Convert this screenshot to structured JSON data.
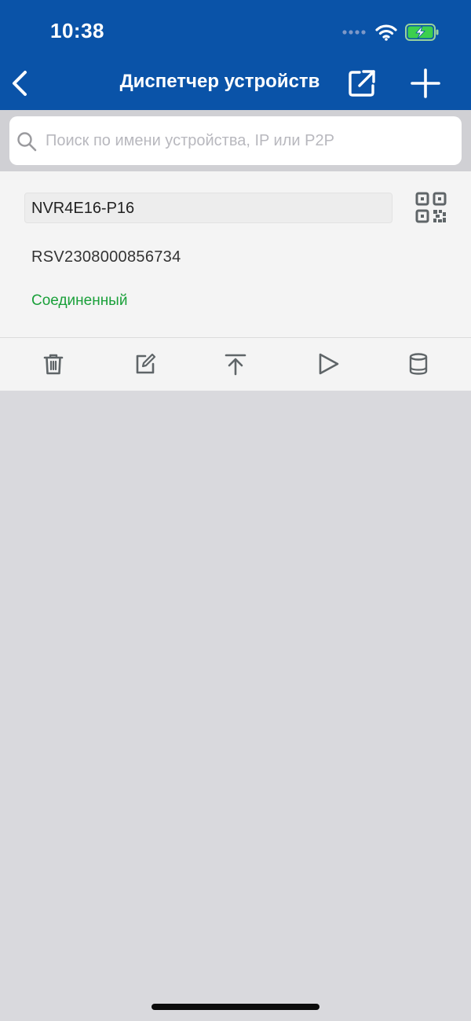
{
  "status_bar": {
    "time": "10:38"
  },
  "nav": {
    "title": "Диспетчер устройств",
    "back_icon": "chevron-left-icon",
    "share_icon": "external-link-icon",
    "add_icon": "plus-icon"
  },
  "search": {
    "placeholder": "Поиск по имени устройства, IP или P2P",
    "value": ""
  },
  "device": {
    "name": "NVR4E16-P16",
    "serial": "RSV2308000856734",
    "status": "Соединенный",
    "qr_icon": "qr-code-icon",
    "actions": [
      {
        "icon": "trash-icon"
      },
      {
        "icon": "edit-icon"
      },
      {
        "icon": "upload-icon"
      },
      {
        "icon": "play-icon"
      },
      {
        "icon": "storage-icon"
      }
    ]
  },
  "colors": {
    "header_bg": "#0a53a8",
    "status_connected": "#1aa03a",
    "icon_gray": "#5f6568",
    "page_bg": "#d9d9dd"
  }
}
